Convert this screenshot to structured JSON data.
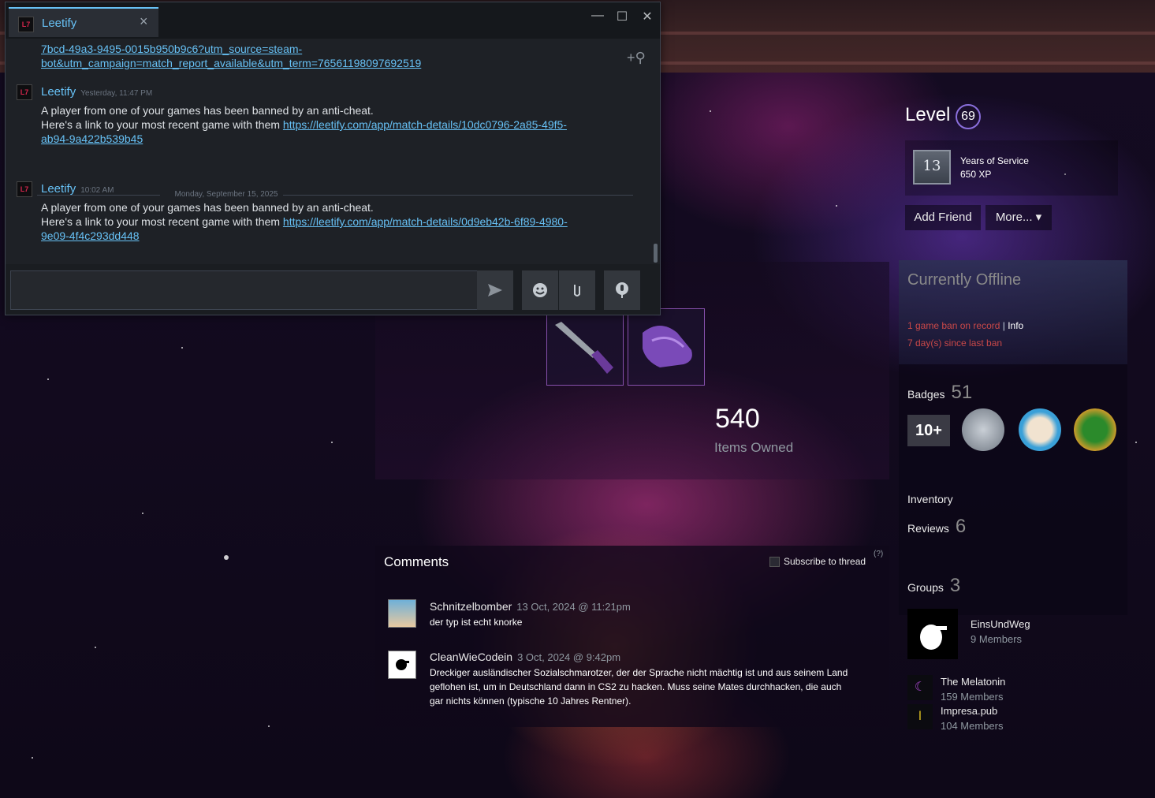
{
  "chat": {
    "tab_title": "Leetify",
    "tab_logo": "L7",
    "window_controls": {
      "minimize": "—",
      "maximize": "☐",
      "close": "✕"
    },
    "top_link_line1": "7bcd-49a3-9495-0015b950b9c6?utm_source=steam-",
    "top_link_line2": "bot&utm_campaign=match_report_available&utm_term=76561198097692519",
    "messages": [
      {
        "sender": "Leetify",
        "timestamp": "Yesterday, 11:47 PM",
        "line1": "A player from one of your games has been banned by an anti-cheat.",
        "line2_prefix": "Here's a link to your most recent game with them ",
        "link_part1": "https://leetify.com/app/match-details/10dc0796-2a85-49f5-",
        "link_part2": "ab94-9a422b539b45"
      },
      {
        "sender": "Leetify",
        "timestamp": "10:02 AM",
        "line1": "A player from one of your games has been banned by an anti-cheat.",
        "line2_prefix": "Here's a link to your most recent game with them ",
        "link_part1": "https://leetify.com/app/match-details/0d9eb42b-6f89-4980-",
        "link_part2": "9e09-4f4c293dd448"
      }
    ],
    "day_separator": "Monday, September 15, 2025",
    "input_value": "",
    "icons": {
      "add_friend": "add-friend-icon",
      "send": "send-icon",
      "emoji": "emoji-icon",
      "attach": "paperclip-icon",
      "voice": "microphone-icon"
    }
  },
  "profile": {
    "level_label": "Level",
    "level_value": "69",
    "service_badge_number": "13",
    "service_title": "Years of Service",
    "service_xp": "650 XP",
    "add_friend_label": "Add Friend",
    "more_label": "More... ▾",
    "status": "Currently Offline",
    "ban_text": "1 game ban on record",
    "ban_sep": " | ",
    "ban_info": "Info",
    "ban_days": "7 day(s) since last ban",
    "badges_label": "Badges",
    "badges_count": "51",
    "badge_10_label": "10+",
    "inventory_label": "Inventory",
    "reviews_label": "Reviews",
    "reviews_count": "6",
    "groups_label": "Groups",
    "groups_count": "3",
    "groups": [
      {
        "name": "EinsUndWeg",
        "members": "9 Members"
      },
      {
        "name": "The Melatonin",
        "members": "159 Members"
      },
      {
        "name": "Impresa.pub",
        "members": "104 Members"
      }
    ]
  },
  "showcase": {
    "items_count": "540",
    "items_label": "Items Owned"
  },
  "comments": {
    "title": "Comments",
    "subscribe_label": "Subscribe to thread",
    "help": "(?)",
    "list": [
      {
        "author": "Schnitzelbomber",
        "date": "13 Oct, 2024 @ 11:21pm",
        "text": "der typ ist echt knorke"
      },
      {
        "author": "CleanWieCodein",
        "date": "3 Oct, 2024 @ 9:42pm",
        "text": "Dreckiger ausländischer Sozialschmarotzer, der der Sprache nicht mächtig ist und aus seinem Land geflohen ist, um in Deutschland dann in CS2 zu hacken. Muss seine Mates durchhacken, die auch gar nichts können (typische 10 Jahres Rentner)."
      }
    ]
  },
  "colors": {
    "link": "#67c1f5",
    "ban_red": "#c94848",
    "level_ring": "#8a6fdc",
    "item_border": "#8650ac"
  }
}
